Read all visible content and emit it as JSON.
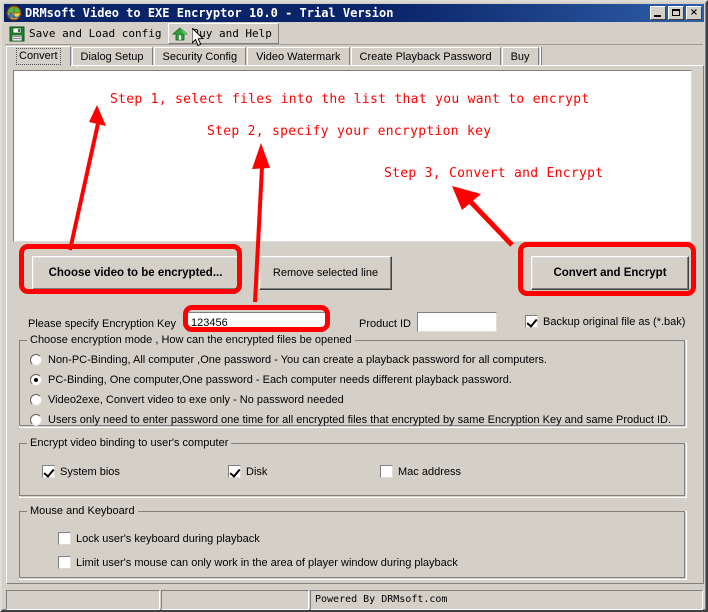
{
  "window": {
    "title": "DRMsoft Video to EXE Encryptor 10.0 - Trial Version",
    "icon": "app-globe-icon",
    "minimize_label": "Minimize",
    "maximize_label": "Maximize",
    "close_label": "×"
  },
  "toolbar": {
    "items": [
      {
        "label": "Save and Load config",
        "icon": "floppy-disk-icon",
        "hovered": false
      },
      {
        "label": "Buy and Help",
        "icon": "green-house-icon",
        "hovered": true
      }
    ]
  },
  "tabs": {
    "items": [
      {
        "label": "Convert",
        "active": true
      },
      {
        "label": "Dialog Setup",
        "active": false
      },
      {
        "label": "Security Config",
        "active": false
      },
      {
        "label": "Video Watermark",
        "active": false
      },
      {
        "label": "Create Playback Password",
        "active": false
      },
      {
        "label": "Buy",
        "active": false
      }
    ]
  },
  "annotations": {
    "steps": [
      {
        "text": "Step 1, select files into the list that you want to encrypt"
      },
      {
        "text": "Step 2, specify your encryption key"
      },
      {
        "text": "Step 3, Convert and Encrypt"
      }
    ],
    "color": "#ff0000"
  },
  "file_list": {
    "items": [],
    "placeholder": ""
  },
  "buttons": {
    "choose_video": "Choose video to be encrypted...",
    "remove_line": "Remove selected line",
    "convert_encrypt": "Convert and Encrypt"
  },
  "key_row": {
    "key_label": "Please specify Encryption Key",
    "key_value": "123456",
    "product_id_label": "Product ID",
    "product_id_value": "",
    "backup_label": "Backup original file as (*.bak)",
    "backup_checked": true
  },
  "encryption_mode": {
    "title": "Choose encryption mode , How can the encrypted files be opened",
    "options": [
      {
        "label": "Non-PC-Binding, All computer ,One password  - You can create a playback password for all computers.",
        "selected": false
      },
      {
        "label": "PC-Binding, One computer,One password  - Each computer needs different playback password.",
        "selected": true
      },
      {
        "label": "Video2exe, Convert video to exe only - No password needed",
        "selected": false
      },
      {
        "label": "Users only need to enter password one time for all encrypted files that encrypted by same Encryption Key and same Product ID.",
        "selected": false
      }
    ]
  },
  "binding": {
    "title": "Encrypt video binding to user's computer",
    "options": [
      {
        "label": "System bios",
        "checked": true
      },
      {
        "label": "Disk",
        "checked": true
      },
      {
        "label": "Mac address",
        "checked": false
      }
    ]
  },
  "mouse_keyboard": {
    "title": "Mouse and Keyboard",
    "options": [
      {
        "label": "Lock user's keyboard during playback",
        "checked": false
      },
      {
        "label": "Limit user's mouse can only work in the area of player window during playback",
        "checked": false
      }
    ]
  },
  "statusbar": {
    "panels": [
      "",
      "",
      "Powered By DRMsoft.com"
    ]
  },
  "colors": {
    "titlebar_start": "#0a246a",
    "titlebar_end": "#2f5fa8",
    "face": "#d4d0c8",
    "annotation_red": "#ff0000"
  }
}
